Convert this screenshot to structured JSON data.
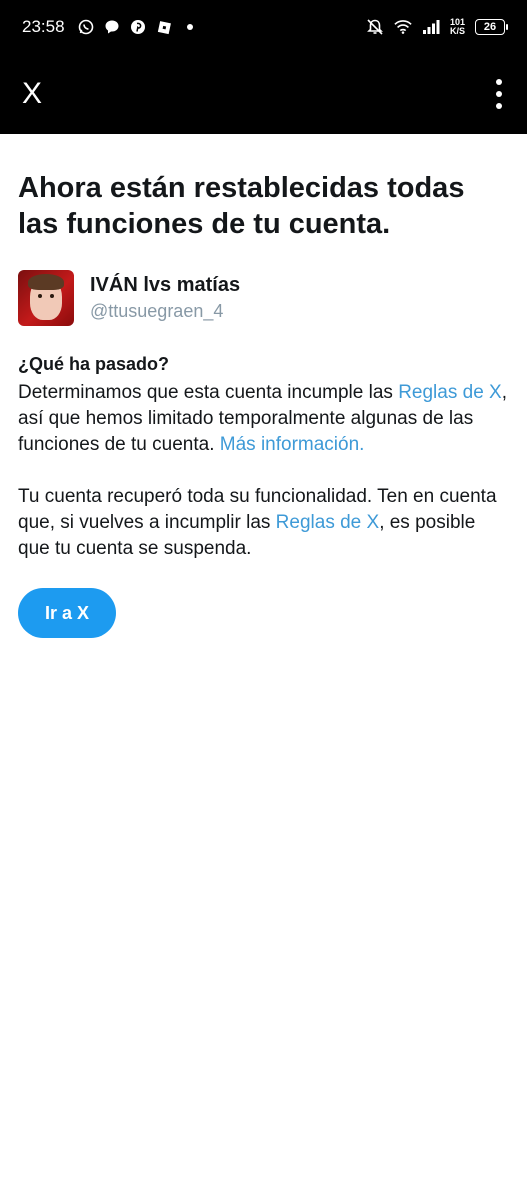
{
  "status_bar": {
    "time": "23:58",
    "net_speed_value": "101",
    "net_speed_unit": "K/S",
    "battery": "26",
    "icons": [
      "whatsapp-icon",
      "messenger-icon",
      "pinterest-icon",
      "roblox-icon",
      "dot-icon",
      "mute-bell-icon",
      "wifi-icon",
      "signal-icon"
    ]
  },
  "appbar": {
    "close_label": "X",
    "more_icon": "more-vertical-icon"
  },
  "main": {
    "title": "Ahora están restablecidas todas las funciones de tu cuenta.",
    "account": {
      "name": "IVÁN lvs matías",
      "handle": "@ttusuegraen_4"
    },
    "section_heading": "¿Qué ha pasado?",
    "para1": {
      "t1": "Determinamos que esta cuenta incumple las ",
      "link1": "Reglas de X",
      "t2": ", así que hemos limitado temporalmente algunas de las funciones de tu cuenta. ",
      "link2": "Más información."
    },
    "para2": {
      "t1": "Tu cuenta recuperó toda su funcionalidad. Ten en cuenta que, si vuelves a incumplir las ",
      "link1": "Reglas de X",
      "t2": ", es posible que tu cuenta se suspenda."
    },
    "cta_label": "Ir a X"
  },
  "colors": {
    "link": "#3e9ad7",
    "button": "#1d9bf0",
    "bar_background": "#000000"
  }
}
